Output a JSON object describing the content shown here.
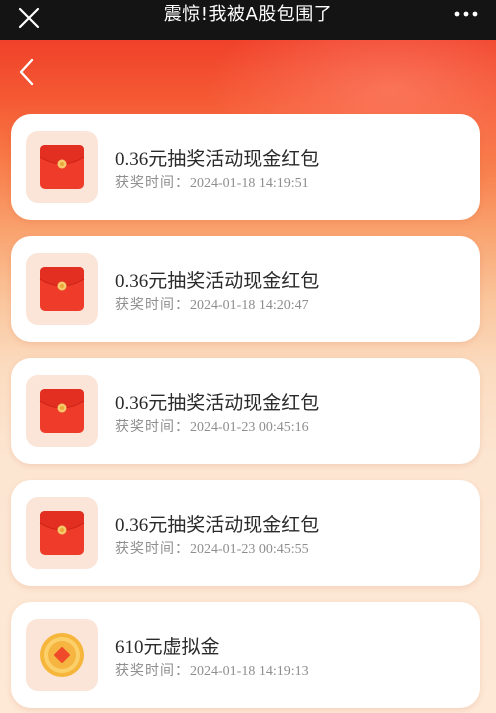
{
  "header": {
    "title": "震惊!我被A股包围了"
  },
  "prize_list": {
    "time_label": "获奖时间：",
    "items": [
      {
        "name": "0.36元抽奖活动现金红包",
        "time": "2024-01-18 14:19:51",
        "icon": "red-envelope-icon"
      },
      {
        "name": "0.36元抽奖活动现金红包",
        "time": "2024-01-18 14:20:47",
        "icon": "red-envelope-icon"
      },
      {
        "name": "0.36元抽奖活动现金红包",
        "time": "2024-01-23 00:45:16",
        "icon": "red-envelope-icon"
      },
      {
        "name": "0.36元抽奖活动现金红包",
        "time": "2024-01-23 00:45:55",
        "icon": "red-envelope-icon"
      },
      {
        "name": "610元虚拟金",
        "time": "2024-01-18 14:19:13",
        "icon": "gold-coin-icon"
      }
    ]
  },
  "colors": {
    "topbar": "#141414",
    "hero_red": "#f0412a",
    "card": "#ffffff",
    "text_primary": "#2a2a2a",
    "text_secondary": "#8e8e8e"
  }
}
